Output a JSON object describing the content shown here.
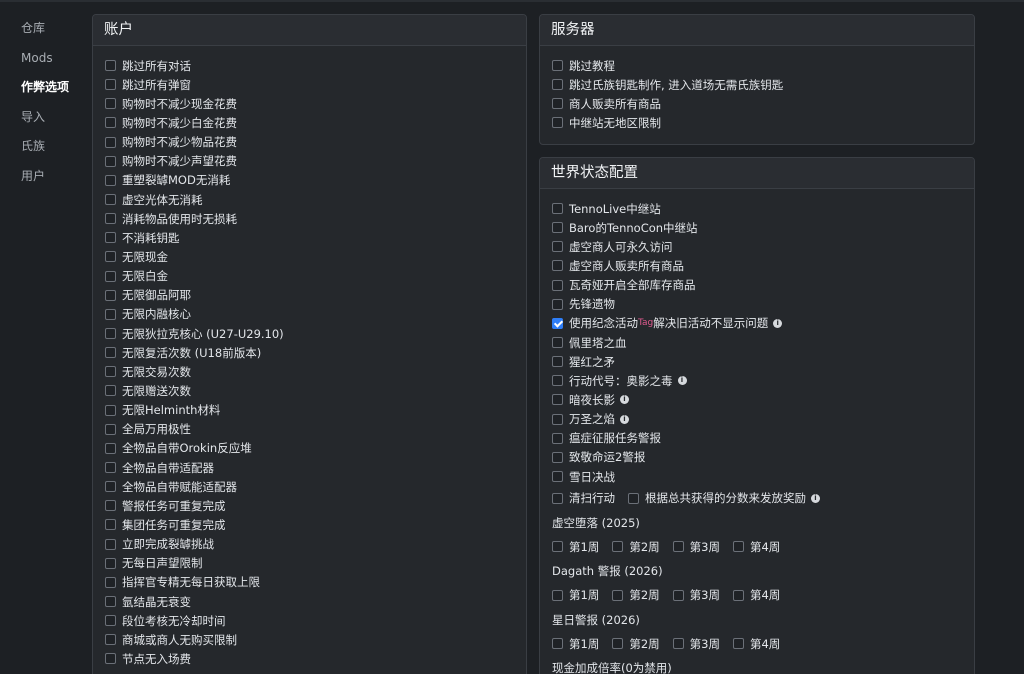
{
  "sidebar": {
    "items": [
      {
        "label": "仓库",
        "active": false
      },
      {
        "label": "Mods",
        "active": false
      },
      {
        "label": "作弊选项",
        "active": true
      },
      {
        "label": "导入",
        "active": false
      },
      {
        "label": "氏族",
        "active": false
      },
      {
        "label": "用户",
        "active": false
      }
    ]
  },
  "account": {
    "title": "账户",
    "options": [
      {
        "label": "跳过所有对话",
        "checked": false
      },
      {
        "label": "跳过所有弹窗",
        "checked": false
      },
      {
        "label": "购物时不减少现金花费",
        "checked": false
      },
      {
        "label": "购物时不减少白金花费",
        "checked": false
      },
      {
        "label": "购物时不减少物品花费",
        "checked": false
      },
      {
        "label": "购物时不减少声望花费",
        "checked": false
      },
      {
        "label": "重塑裂罅MOD无消耗",
        "checked": false
      },
      {
        "label": "虚空光体无消耗",
        "checked": false
      },
      {
        "label": "消耗物品使用时无损耗",
        "checked": false
      },
      {
        "label": "不消耗钥匙",
        "checked": false
      },
      {
        "label": "无限现金",
        "checked": false
      },
      {
        "label": "无限白金",
        "checked": false
      },
      {
        "label": "无限御品阿耶",
        "checked": false
      },
      {
        "label": "无限内融核心",
        "checked": false
      },
      {
        "label": "无限狄拉克核心 (U27-U29.10)",
        "checked": false
      },
      {
        "label": "无限复活次数 (U18前版本)",
        "checked": false
      },
      {
        "label": "无限交易次数",
        "checked": false
      },
      {
        "label": "无限赠送次数",
        "checked": false
      },
      {
        "label": "无限Helminth材料",
        "checked": false
      },
      {
        "label": "全局万用极性",
        "checked": false
      },
      {
        "label": "全物品自带Orokin反应堆",
        "checked": false
      },
      {
        "label": "全物品自带适配器",
        "checked": false
      },
      {
        "label": "全物品自带赋能适配器",
        "checked": false
      },
      {
        "label": "警报任务可重复完成",
        "checked": false
      },
      {
        "label": "集团任务可重复完成",
        "checked": false
      },
      {
        "label": "立即完成裂罅挑战",
        "checked": false
      },
      {
        "label": "无每日声望限制",
        "checked": false
      },
      {
        "label": "指挥官专精无每日获取上限",
        "checked": false
      },
      {
        "label": "氩结晶无衰变",
        "checked": false
      },
      {
        "label": "段位考核无冷却时间",
        "checked": false
      },
      {
        "label": "商城或商人无购买限制",
        "checked": false
      },
      {
        "label": "节点无入场费",
        "checked": false
      }
    ]
  },
  "server": {
    "title": "服务器",
    "options": [
      {
        "label": "跳过教程",
        "checked": false
      },
      {
        "label": "跳过氏族钥匙制作, 进入道场无需氏族钥匙",
        "checked": false
      },
      {
        "label": "商人贩卖所有商品",
        "checked": false
      },
      {
        "label": "中继站无地区限制",
        "checked": false
      }
    ]
  },
  "world": {
    "title": "世界状态配置",
    "options": [
      {
        "label": "TennoLive中继站",
        "checked": false,
        "info": false
      },
      {
        "label": "Baro的TennoCon中继站",
        "checked": false,
        "info": false
      },
      {
        "label": "虚空商人可永久访问",
        "checked": false,
        "info": false
      },
      {
        "label": "虚空商人贩卖所有商品",
        "checked": false,
        "info": false
      },
      {
        "label": "瓦奇娅开启全部库存商品",
        "checked": false,
        "info": false
      },
      {
        "label": "先锋遗物",
        "checked": false,
        "info": false
      },
      {
        "label": "佩里塔之血",
        "checked": false,
        "info": false
      },
      {
        "label": "猩红之矛",
        "checked": false,
        "info": false
      },
      {
        "label": "行动代号：奥影之毒",
        "checked": false,
        "info": true
      },
      {
        "label": "暗夜长影",
        "checked": false,
        "info": true
      },
      {
        "label": "万圣之焰",
        "checked": false,
        "info": true
      },
      {
        "label": "瘟症征服任务警报",
        "checked": false,
        "info": false
      },
      {
        "label": "致敬命运2警报",
        "checked": false,
        "info": false
      },
      {
        "label": "雪日决战",
        "checked": false,
        "info": false
      }
    ],
    "memorial": {
      "prefix": "使用纪念活动",
      "tag": "Tag",
      "suffix": "解决旧活动不显示问题",
      "checked": true
    },
    "cleanup": {
      "label": "清扫行动",
      "extra_label": "根据总共获得的分数来发放奖励"
    },
    "groups": [
      {
        "title": "虚空堕落 (2025)",
        "weeks": [
          "第1周",
          "第2周",
          "第3周",
          "第4周"
        ]
      },
      {
        "title": "Dagath 警报 (2026)",
        "weeks": [
          "第1周",
          "第2周",
          "第3周",
          "第4周"
        ]
      },
      {
        "title": "星日警报 (2026)",
        "weeks": [
          "第1周",
          "第2周",
          "第3周",
          "第4周"
        ]
      }
    ],
    "credit_multiplier_label": "现金加成倍率(0为禁用)"
  },
  "icons": {
    "info": "info-circle-icon",
    "check": "check-icon"
  },
  "colors": {
    "accent": "#2f7ef7",
    "tag": "#e05a8f",
    "background": "#1d2024",
    "card": "#25282c"
  }
}
